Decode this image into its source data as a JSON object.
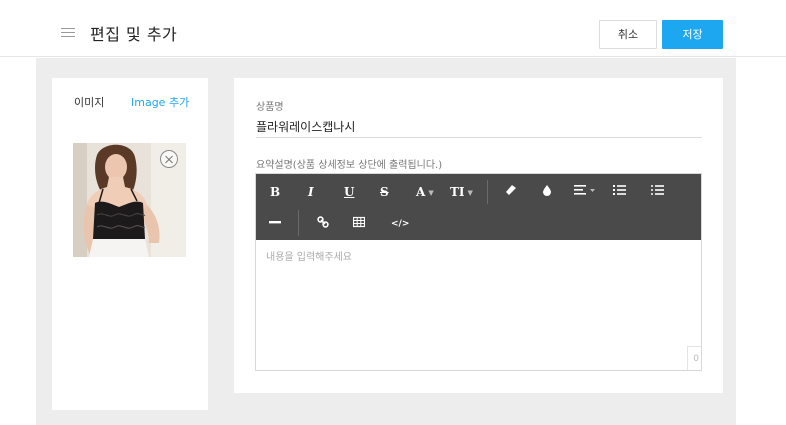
{
  "header": {
    "title": "편집 및 추가",
    "cancel_label": "취소",
    "save_label": "저장"
  },
  "image_panel": {
    "title": "이미지",
    "add_link": "Image 추가"
  },
  "form": {
    "name_label": "상품명",
    "name_value": "플라워레이스캡나시",
    "desc_label": "요약설명(상품 상세정보 상단에 출력됩니다.)",
    "desc_placeholder": "내용을 입력해주세요",
    "char_count": "0"
  },
  "toolbar": {
    "bold": "B",
    "italic": "I",
    "underline": "U",
    "strike": "S",
    "font_color": "A",
    "font_size": "TI",
    "code": "</>"
  },
  "colors": {
    "accent": "#1ea7f1",
    "toolbar_bg": "#4a4a4a",
    "content_bg": "#ededed"
  },
  "icons": [
    "menu-icon",
    "close-circle-icon",
    "eraser-icon",
    "fill-drop-icon",
    "align-icon",
    "ordered-list-icon",
    "unordered-list-icon",
    "horizontal-rule-icon",
    "link-icon",
    "table-icon",
    "code-icon"
  ]
}
